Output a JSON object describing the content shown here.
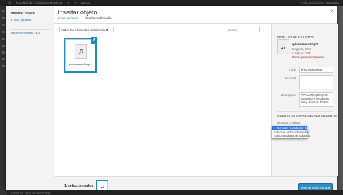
{
  "admin_bar": {
    "site_name": "Facultad de Periodismo TecMedia",
    "updates": "2",
    "comments": "0",
    "new_label": "Nuevo",
    "greeting": "Hola, Periodismo TecMedia"
  },
  "modal": {
    "close_glyph": "×",
    "title": "Insertar objeto",
    "router": {
      "upload_tab": "Subir archivos",
      "library_tab": "Librería multimedia"
    },
    "menu": {
      "insert_media": "Insertar objeto",
      "create_gallery": "Crear galería",
      "insert_from_url": "Insertar desde URL"
    },
    "filter_select": "Todos los elementos multimedia ⬍",
    "search_placeholder": "Buscar",
    "attachments": [
      {
        "icon": "audio-file-icon",
        "glyph": "♫",
        "filename": "iphoneremix3.mp3",
        "checked_glyph": "✔"
      }
    ],
    "details": {
      "heading": "DETALLES DE ADJUNTOS",
      "glyph": "♫",
      "filename": "iphoneremix3.mp3",
      "date": "5 agosto, 2013",
      "length": "Longitud: 0:24",
      "delete_link": "Borrar permanentemente",
      "title_label": "Título",
      "title_value": "iPhoneRingRing",
      "caption_label": "Leyenda",
      "caption_value": "",
      "description_label": "Descripción",
      "description_value": "\"iPhoneRingRing\" de Maxwold Reynole por Integ Género: iPhone."
    },
    "display_settings": {
      "heading": "AJUSTES DE LA PANTALLA DE ADJUNTOS",
      "embed_label": "Incrustar o enlazar",
      "options": [
        "✓ Incrustar reproductor de medios",
        "Enlace al archivo de medios",
        "Enlace a página de adjuntos"
      ]
    },
    "footer": {
      "selected_count": "1 seleccionados",
      "clear_link": "Borrar",
      "thumb_glyph": "♫",
      "insert_button": "Insertar en la entrada"
    }
  },
  "bottom_bar": {
    "text": "Gracias por crear con WordPress."
  },
  "colors": {
    "accent": "#1e8cbe",
    "link": "#21759b",
    "danger": "#bc0b0b",
    "primary_button": "#2e8fc4"
  }
}
